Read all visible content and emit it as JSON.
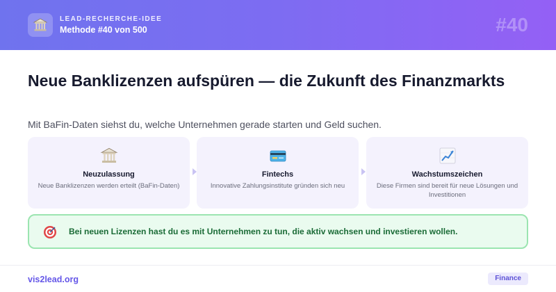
{
  "header": {
    "kicker": "LEAD-RECHERCHE-IDEE",
    "method": "Methode #40 von 500",
    "number": "#40",
    "logo_icon": "bank-icon"
  },
  "main": {
    "title": "Neue Banklizenzen aufspüren — die Zukunft des Finanzmarkts",
    "subtitle": "Mit BaFin-Daten siehst du, welche Unternehmen gerade starten und Geld suchen."
  },
  "steps": [
    {
      "icon": "bank-icon",
      "title": "Neuzulassung",
      "desc": "Neue Banklizenzen werden erteilt (BaFin-Daten)"
    },
    {
      "icon": "credit-card-icon",
      "title": "Fintechs",
      "desc": "Innovative Zahlungsinstitute gründen sich neu"
    },
    {
      "icon": "chart-up-icon",
      "title": "Wachstumszeichen",
      "desc": "Diese Firmen sind bereit für neue Lösungen und Investitionen"
    }
  ],
  "callout": {
    "icon": "target-icon",
    "text": "Bei neuen Lizenzen hast du es mit Unternehmen zu tun, die aktiv wachsen und investieren wollen."
  },
  "footer": {
    "link": "vis2lead.org",
    "badge": "Finance"
  },
  "colors": {
    "header_start": "#6f73ee",
    "header_end": "#9460f5",
    "accent": "#6557e8",
    "callout_bg": "#eafbef",
    "callout_border": "#9be5b0",
    "callout_text": "#1a6b36"
  }
}
